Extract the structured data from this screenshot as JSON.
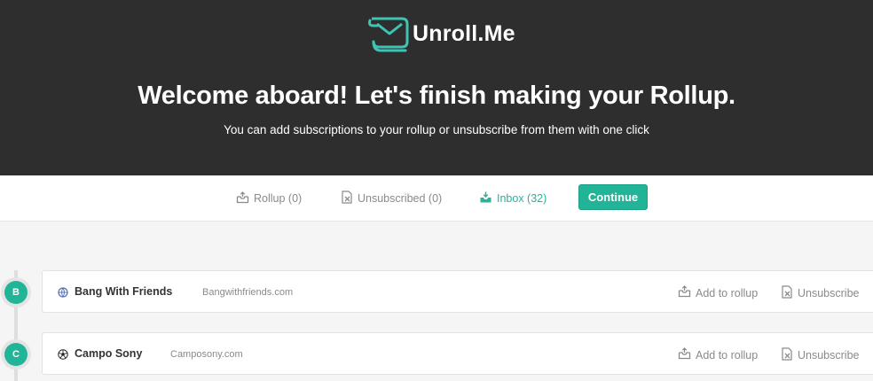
{
  "brand": {
    "name": "Unroll.Me",
    "logo_icon": "scroll-envelope-icon",
    "accent_color": "#22b496"
  },
  "hero": {
    "title": "Welcome aboard! Let's finish making your Rollup.",
    "subtitle": "You can add subscriptions to your rollup or unsubscribe from them with one click"
  },
  "tabs": [
    {
      "label": "Rollup (0)",
      "icon": "rollup-inbox-icon",
      "active": false
    },
    {
      "label": "Unsubscribed (0)",
      "icon": "unsubscribe-icon",
      "active": false
    },
    {
      "label": "Inbox (32)",
      "icon": "inbox-download-icon",
      "active": true
    }
  ],
  "continue_label": "Continue",
  "groups": [
    {
      "letter": "B",
      "subscriptions": [
        {
          "name": "Bang With Friends",
          "domain": "Bangwithfriends.com",
          "icon": "globe-icon",
          "add_label": "Add to rollup",
          "unsubscribe_label": "Unsubscribe"
        }
      ]
    },
    {
      "letter": "C",
      "subscriptions": [
        {
          "name": "Campo Sony",
          "domain": "Camposony.com",
          "icon": "soccer-ball-icon",
          "add_label": "Add to rollup",
          "unsubscribe_label": "Unsubscribe"
        }
      ]
    }
  ]
}
